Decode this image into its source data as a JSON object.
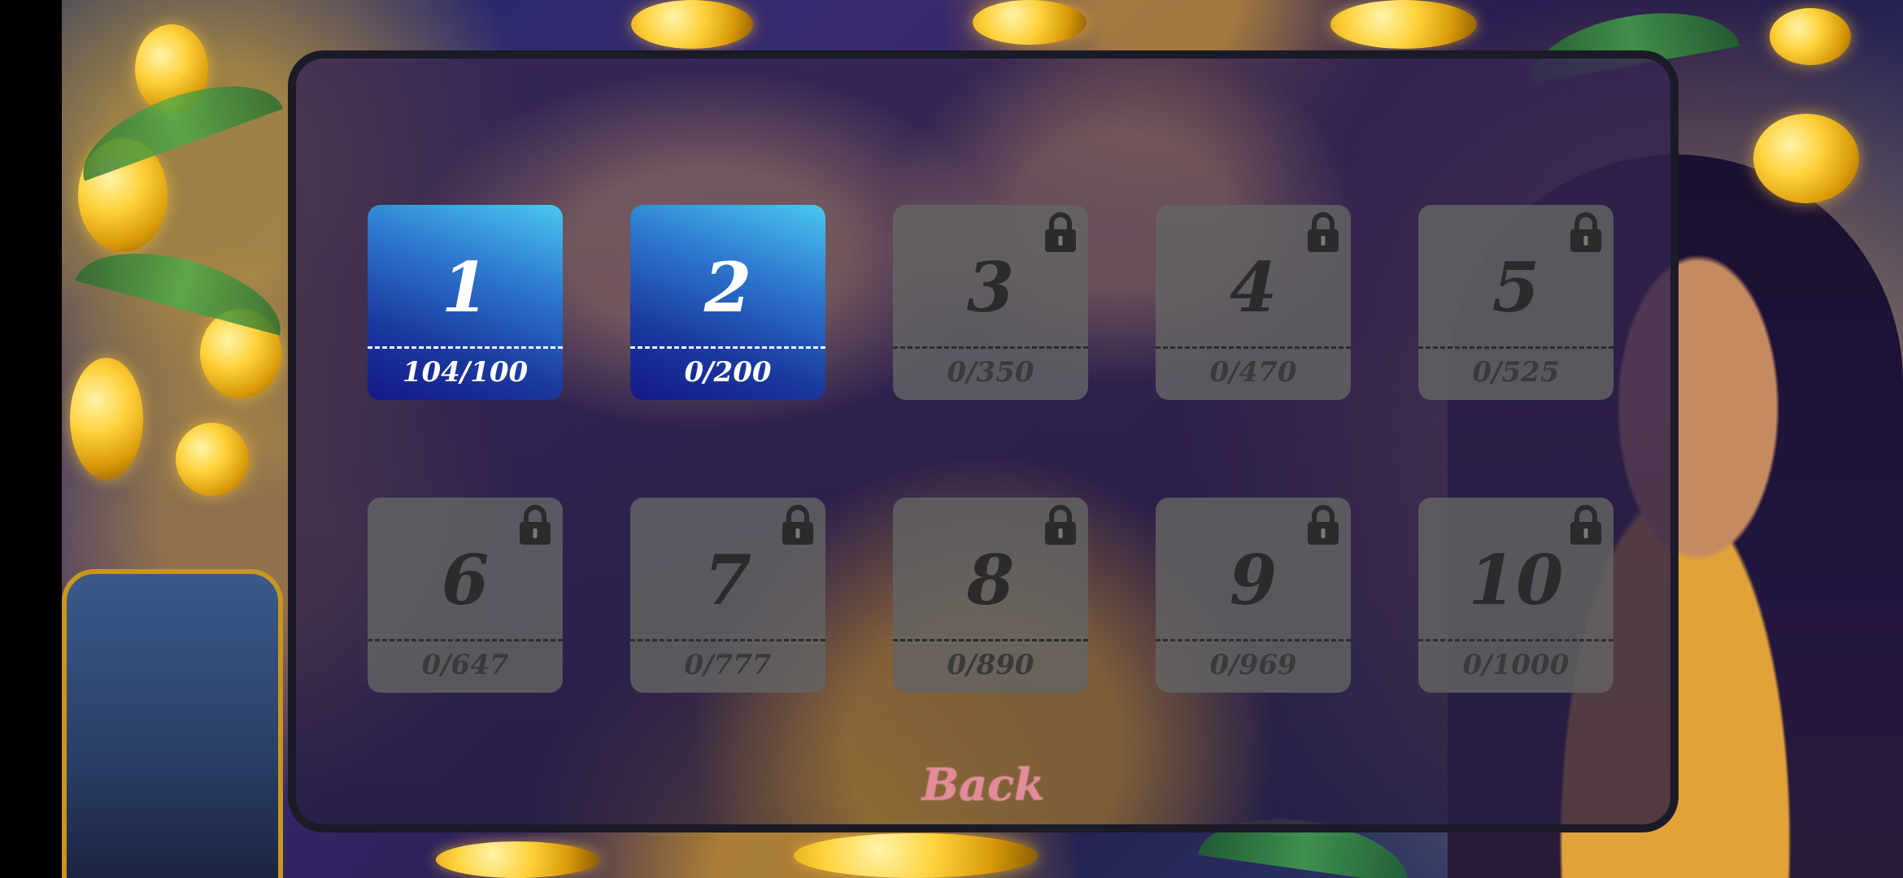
{
  "levels": [
    {
      "number": "1",
      "progress": "104/100",
      "locked": false
    },
    {
      "number": "2",
      "progress": "0/200",
      "locked": false
    },
    {
      "number": "3",
      "progress": "0/350",
      "locked": true
    },
    {
      "number": "4",
      "progress": "0/470",
      "locked": true
    },
    {
      "number": "5",
      "progress": "0/525",
      "locked": true
    },
    {
      "number": "6",
      "progress": "0/647",
      "locked": true
    },
    {
      "number": "7",
      "progress": "0/777",
      "locked": true
    },
    {
      "number": "8",
      "progress": "0/890",
      "locked": true
    },
    {
      "number": "9",
      "progress": "0/969",
      "locked": true
    },
    {
      "number": "10",
      "progress": "0/1000",
      "locked": true
    }
  ],
  "back_label": "Back",
  "icons": {
    "lock": "lock-icon"
  },
  "colors": {
    "unlocked_top": "#49c8ef",
    "unlocked_bottom": "#15188a",
    "locked_tile": "#646464",
    "back_text": "#e48a9a"
  }
}
